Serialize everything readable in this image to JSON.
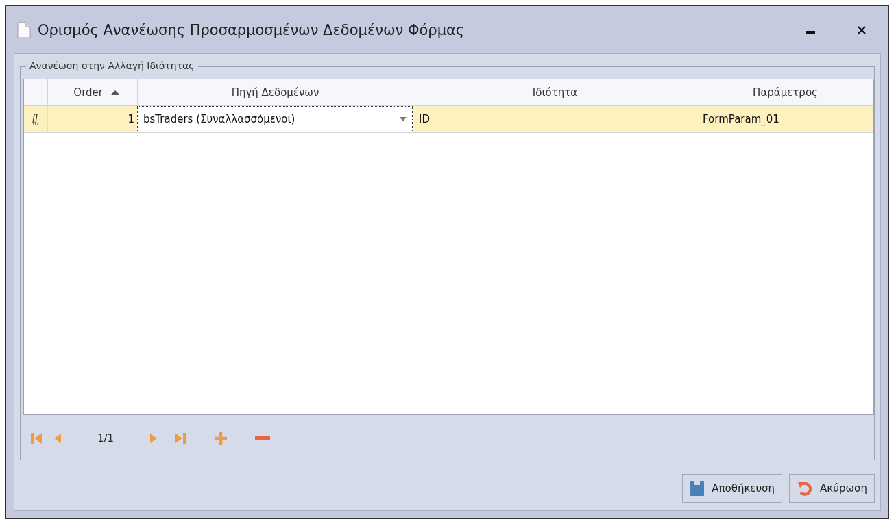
{
  "window": {
    "title": "Ορισμός Ανανέωσης Προσαρμοσμένων Δεδομένων Φόρμας"
  },
  "group": {
    "title": "Ανανέωση στην Αλλαγή Ιδιότητας"
  },
  "table": {
    "columns": [
      {
        "label": "Order",
        "sorted": true
      },
      {
        "label": "Πηγή Δεδομένων",
        "sorted": false
      },
      {
        "label": "Ιδιότητα",
        "sorted": false
      },
      {
        "label": "Παράμετρος",
        "sorted": false
      }
    ],
    "rows": [
      {
        "selected": true,
        "cells": [
          {
            "kind": "text",
            "text": "1"
          },
          {
            "kind": "dropdown",
            "text": "bsTraders (Συναλλασσόμενοι)"
          },
          {
            "kind": "text",
            "text": "ID"
          },
          {
            "kind": "text",
            "text": "FormParam_01"
          }
        ]
      }
    ]
  },
  "navigator": {
    "position": "1/1"
  },
  "buttons": [
    {
      "kind": "save",
      "label": "Αποθήκευση"
    },
    {
      "kind": "cancel",
      "label": "Ακύρωση"
    }
  ]
}
